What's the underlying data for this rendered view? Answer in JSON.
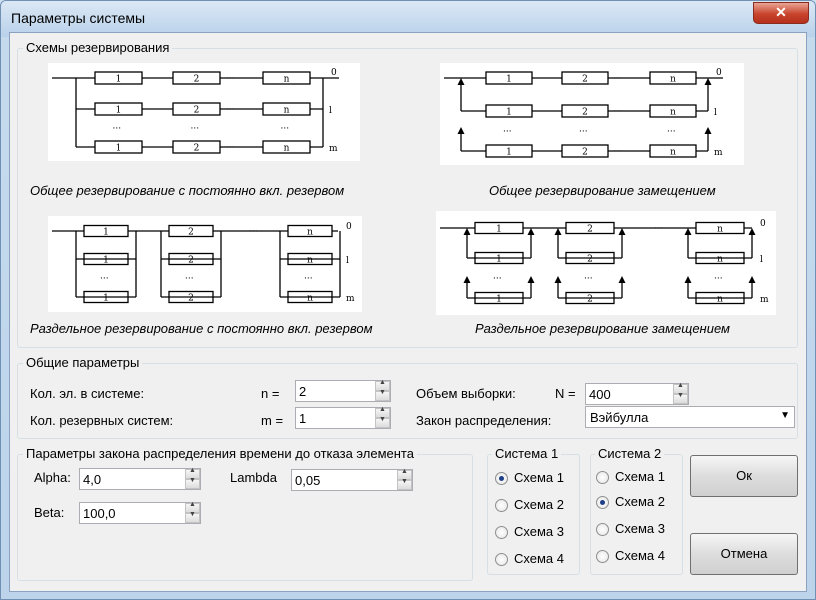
{
  "window": {
    "title": "Параметры системы",
    "close_symbol": "✕"
  },
  "schemes": {
    "legend": "Схемы резервирования",
    "captions": [
      "Общее резервирование с постоянно вкл. резервом",
      "Общее резервирование замещением",
      "Раздельное резервирование с постоянно вкл. резервом",
      "Раздельное резервирование замещением"
    ],
    "diagram_labels": {
      "b1": "1",
      "b2": "2",
      "bn": "n",
      "ell": "···",
      "r0": "0",
      "r1": "l",
      "rm": "m"
    }
  },
  "general": {
    "legend": "Общие параметры",
    "elements_label": "Кол. эл. в системе:",
    "n_label": "n =",
    "n_value": "2",
    "reserve_label": "Кол. резервных систем:",
    "m_label": "m =",
    "m_value": "1",
    "sample_label": "Объем выборки:",
    "N_label": "N =",
    "N_value": "400",
    "law_label": "Закон распределения:",
    "law_value": "Вэйбулла"
  },
  "dist": {
    "legend": "Параметры закона распределения времени до отказа элемента",
    "alpha_label": "Alpha:",
    "alpha_value": "4,0",
    "lambda_label": "Lambda",
    "lambda_value": "0,05",
    "beta_label": "Beta:",
    "beta_value": "100,0"
  },
  "system1": {
    "legend": "Система 1",
    "options": [
      "Схема 1",
      "Схема 2",
      "Схема 3",
      "Схема 4"
    ],
    "selected": 0
  },
  "system2": {
    "legend": "Система 2",
    "options": [
      "Схема 1",
      "Схема 2",
      "Схема 3",
      "Схема 4"
    ],
    "selected": 1
  },
  "buttons": {
    "ok": "Ок",
    "cancel": "Отмена"
  }
}
